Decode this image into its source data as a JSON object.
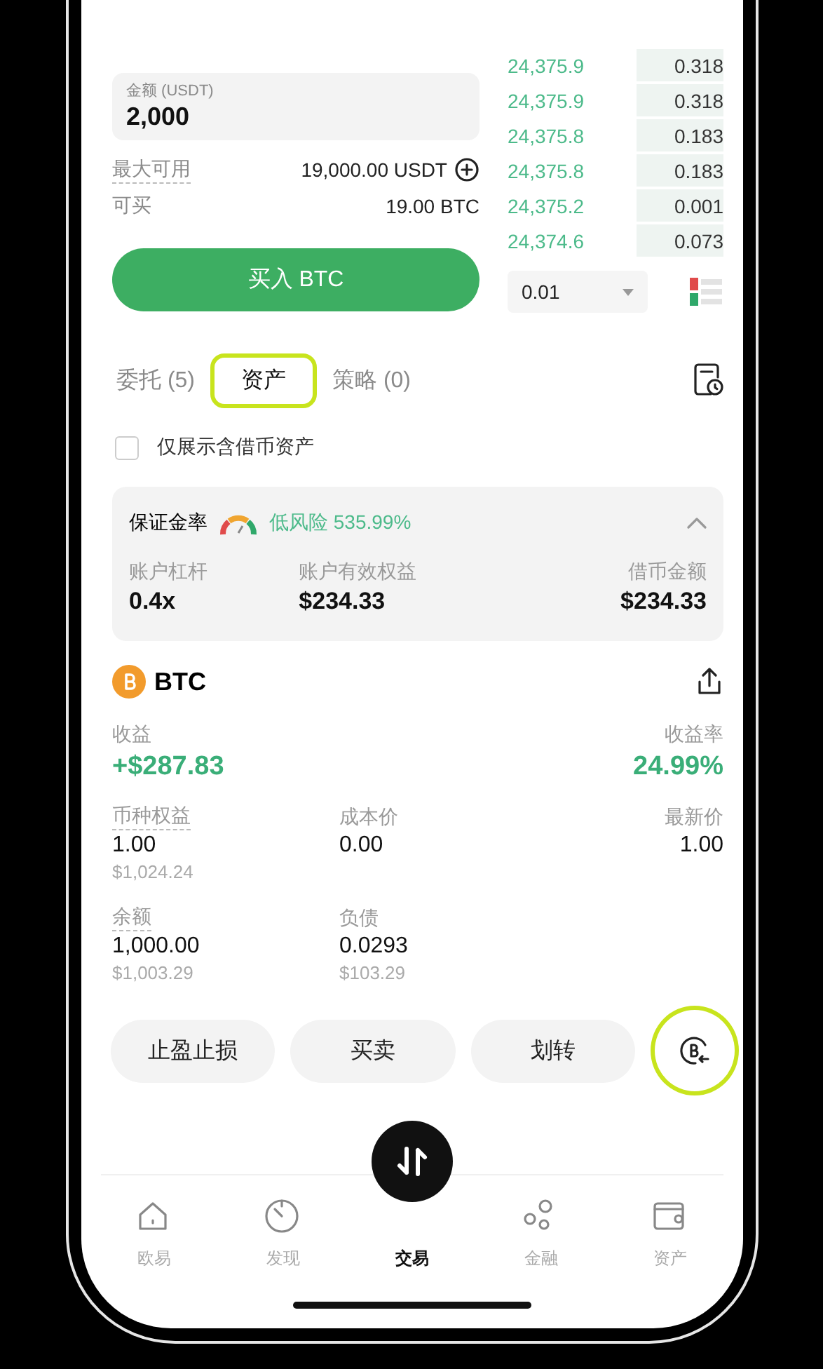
{
  "order_form": {
    "amount_field": {
      "label": "金额 (USDT)",
      "value": "2,000"
    },
    "max_available": {
      "label": "最大可用",
      "value": "19,000.00 USDT"
    },
    "can_buy": {
      "label": "可买",
      "value": "19.00 BTC"
    },
    "buy_button": "买入 BTC"
  },
  "order_book": {
    "rows": [
      {
        "price": "24,375.9",
        "amount": "0.318"
      },
      {
        "price": "24,375.9",
        "amount": "0.318"
      },
      {
        "price": "24,375.8",
        "amount": "0.183"
      },
      {
        "price": "24,375.8",
        "amount": "0.183"
      },
      {
        "price": "24,375.2",
        "amount": "0.001"
      },
      {
        "price": "24,374.6",
        "amount": "0.073"
      }
    ],
    "precision": "0.01"
  },
  "tabs": [
    {
      "label": "委托 (5)",
      "selected": false,
      "highlighted": false
    },
    {
      "label": "资产",
      "selected": true,
      "highlighted": true
    },
    {
      "label": "策略 (0)",
      "selected": false,
      "highlighted": false
    }
  ],
  "filter": {
    "label": "仅展示含借币资产",
    "checked": false
  },
  "margin": {
    "label": "保证金率",
    "risk": "低风险 535.99%",
    "expanded": true,
    "stats": [
      {
        "label": "账户杠杆",
        "value": "0.4x"
      },
      {
        "label": "账户有效权益",
        "value": "$234.33"
      },
      {
        "label": "借币金额",
        "value": "$234.33"
      }
    ]
  },
  "asset": {
    "coin": "BTC",
    "pnl": {
      "label": "收益",
      "value": "+$287.83"
    },
    "pnl_rate": {
      "label": "收益率",
      "value": "24.99%"
    },
    "fields": [
      {
        "label": "币种权益",
        "value": "1.00",
        "sub": "$1,024.24",
        "underlined": true
      },
      {
        "label": "成本价",
        "value": "0.00",
        "underlined": false
      },
      {
        "label": "最新价",
        "value": "1.00",
        "underlined": false
      },
      {
        "label": "余额",
        "value": "1,000.00",
        "sub": "$1,003.29",
        "underlined": true
      },
      {
        "label": "负债",
        "value": "0.0293",
        "sub": "$103.29",
        "underlined": false
      }
    ]
  },
  "actions": [
    {
      "kind": "text",
      "label": "止盈止损",
      "highlighted": false
    },
    {
      "kind": "text",
      "label": "买卖",
      "highlighted": false
    },
    {
      "kind": "text",
      "label": "划转",
      "highlighted": false
    },
    {
      "kind": "icon",
      "highlighted": true
    }
  ],
  "nav": [
    {
      "kind": "home",
      "label": "欧易",
      "selected": false
    },
    {
      "kind": "discover",
      "label": "发现",
      "selected": false
    },
    {
      "kind": "trade",
      "label": "交易",
      "selected": true
    },
    {
      "kind": "finance",
      "label": "金融",
      "selected": false
    },
    {
      "kind": "wallet",
      "label": "资产",
      "selected": false
    }
  ]
}
